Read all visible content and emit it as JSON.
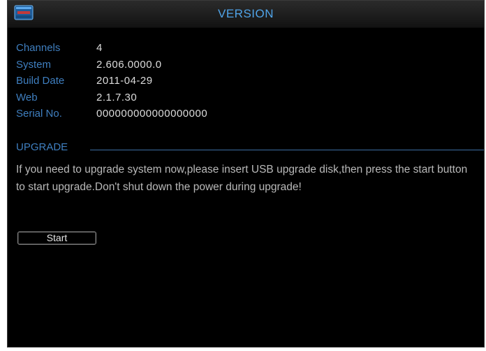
{
  "window": {
    "title": "VERSION",
    "accent_color": "#4fa3e8",
    "label_color": "#3f7fc0",
    "icon": "monitor-icon"
  },
  "info": {
    "channels": {
      "label": "Channels",
      "value": "4"
    },
    "system": {
      "label": "System",
      "value": "2.606.0000.0"
    },
    "build_date": {
      "label": "Build Date",
      "value": "2011-04-29"
    },
    "web": {
      "label": "Web",
      "value": "2.1.7.30"
    },
    "serial_no": {
      "label": "Serial No.",
      "value": "000000000000000000"
    }
  },
  "upgrade": {
    "section_label": "UPGRADE",
    "message": "If you need to upgrade system now,please insert USB upgrade disk,then press the start button to start upgrade.Don't shut down the power during upgrade!",
    "start_label": "Start"
  }
}
